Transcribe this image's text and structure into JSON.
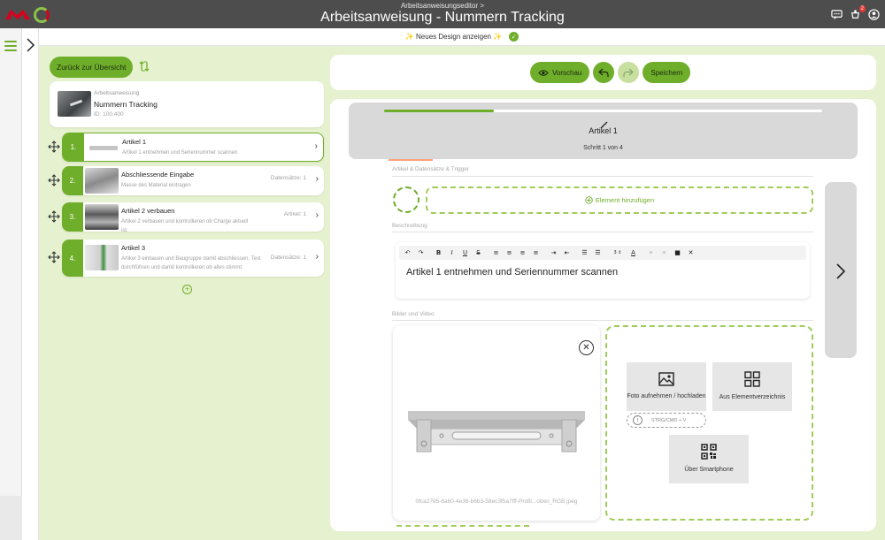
{
  "header": {
    "breadcrumb": "Arbeitsanweisungseditor >",
    "title": "Arbeitsanweisung - Nummern Tracking",
    "notification_count": "2"
  },
  "banner": {
    "text": "✨ Neues Design anzeigen ✨"
  },
  "sidebar": {
    "back_label": "Zurück zur Übersicht",
    "instruction": {
      "type_label": "Arbeitsanweisung",
      "name": "Nummern Tracking",
      "id": "ID: 100.400"
    },
    "steps": [
      {
        "num": "1.",
        "title": "Artikel 1",
        "desc": "Artikel 1 entnehmen und Seriennummer scannen",
        "meta": ""
      },
      {
        "num": "2.",
        "title": "Abschliessende Eingabe",
        "desc": "Masse des Material eintragen",
        "meta": "Datensätze: 1"
      },
      {
        "num": "3.",
        "title": "Artikel 2 verbauen",
        "desc": "Artikel 2 verbauen und kontrollieren ob Charge aktuell ist.",
        "meta": "Artikel: 1"
      },
      {
        "num": "4.",
        "title": "Artikel 3",
        "desc": "Artikel 3 einbauen und Baugruppe damit abschliessen. Test durchführen und damit kontrollieren ob alles stimmt.",
        "meta": "Datensätze: 1"
      }
    ]
  },
  "toolbar": {
    "preview_label": "Vorschau",
    "save_label": "Speichern"
  },
  "editor": {
    "progress": 0.25,
    "step_title": "Artikel 1",
    "step_count": "Schritt 1 von 4",
    "section_items": "Artikel & Datensätze & Trigger",
    "add_element_label": "Element hinzufügen",
    "section_description": "Beschreibung",
    "description_text": "Artikel 1 entnehmen und Seriennummer scannen",
    "section_media": "Bilder und Video",
    "image_filename": "0fca2795-6a60-4e36-b6b3-58ec3f5a7fff-Profil...oben_RGB.jpeg",
    "tile_upload": "Foto aufnehmen / hochladen",
    "paste_shortcut": "STRG/CMD + V",
    "tile_library": "Aus Elementverzeichnis",
    "tile_smartphone": "Über Smartphone"
  },
  "colors": {
    "accent": "#6fae2a",
    "page_background": "#e6f2cf",
    "topbar": "#4d4d4d"
  }
}
